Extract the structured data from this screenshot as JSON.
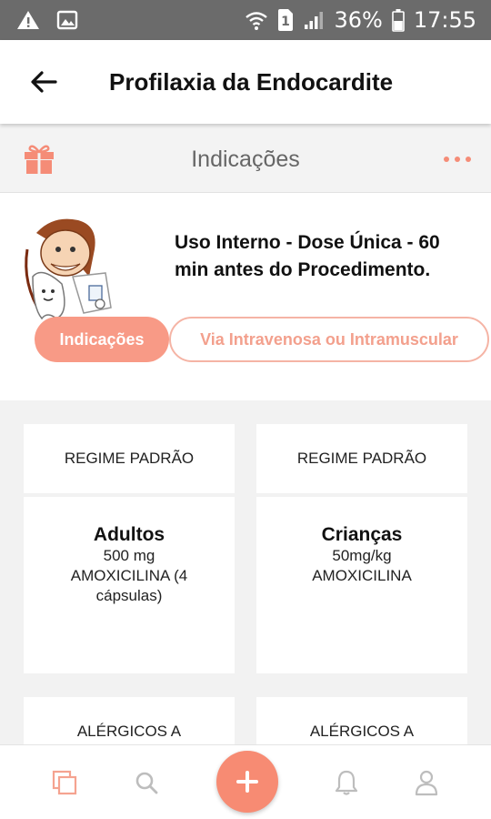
{
  "status_bar": {
    "battery": "36%",
    "time": "17:55",
    "sim": "1"
  },
  "header": {
    "title": "Profilaxia da Endocardite"
  },
  "section": {
    "title": "Indicações"
  },
  "info": {
    "text": "Uso Interno - Dose Única - 60 min antes do Procedimento."
  },
  "tabs": [
    {
      "label": "Indicações",
      "active": true
    },
    {
      "label": "Via Intravenosa ou Intramuscular",
      "active": false
    }
  ],
  "cards": [
    {
      "header": "REGIME PADRÃO",
      "title": "Adultos",
      "lines": [
        "500 mg",
        "AMOXICILINA (4",
        "cápsulas)"
      ]
    },
    {
      "header": "REGIME PADRÃO",
      "title": "Crianças",
      "lines": [
        "50mg/kg",
        "AMOXICILINA"
      ]
    },
    {
      "header": "ALÉRGICOS A"
    },
    {
      "header": "ALÉRGICOS A"
    }
  ],
  "colors": {
    "accent": "#f78b73",
    "accent_light": "#f5b4a5",
    "icon_gray": "#bdbdbd"
  },
  "icons": {
    "back": "arrow-left-icon",
    "gift": "gift-icon",
    "more": "more-horizontal-icon",
    "nav": [
      "copy-icon",
      "search-icon",
      "plus-icon",
      "bell-icon",
      "user-icon"
    ]
  }
}
